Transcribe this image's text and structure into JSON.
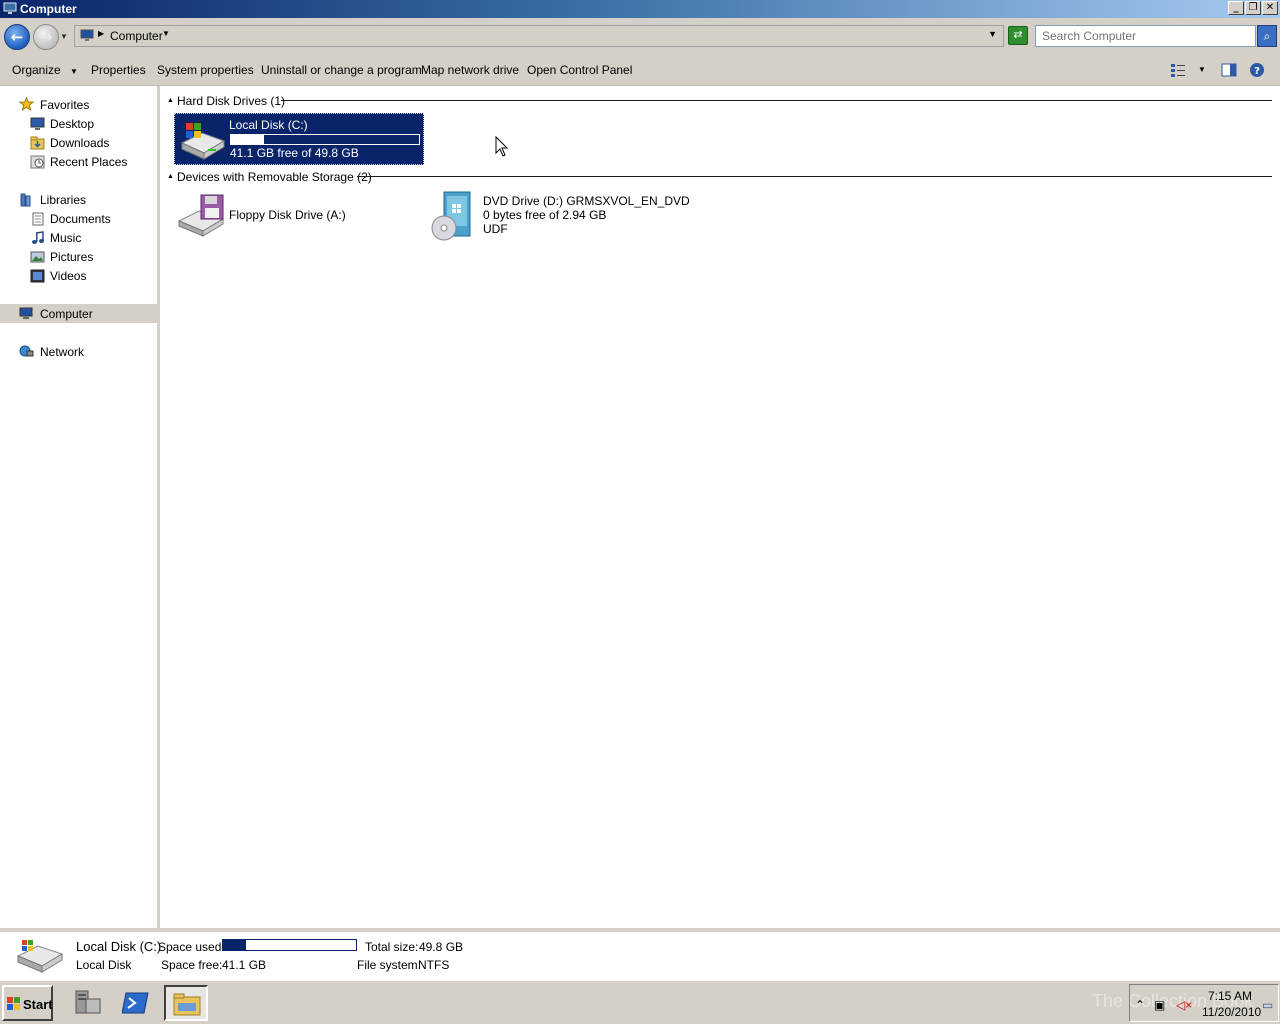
{
  "window": {
    "title": "Computer"
  },
  "address": {
    "crumb": "Computer"
  },
  "search": {
    "placeholder": "Search Computer"
  },
  "toolbar": {
    "organize": "Organize",
    "properties": "Properties",
    "system_properties": "System properties",
    "uninstall": "Uninstall or change a program",
    "map_drive": "Map network drive",
    "control_panel": "Open Control Panel"
  },
  "nav": {
    "favorites": "Favorites",
    "desktop": "Desktop",
    "downloads": "Downloads",
    "recent": "Recent Places",
    "libraries": "Libraries",
    "documents": "Documents",
    "music": "Music",
    "pictures": "Pictures",
    "videos": "Videos",
    "computer": "Computer",
    "network": "Network"
  },
  "groups": {
    "hdd": "Hard Disk Drives (1)",
    "removable": "Devices with Removable Storage (2)"
  },
  "drives": {
    "c": {
      "name": "Local Disk (C:)",
      "free_text": "41.1 GB free of 49.8 GB",
      "used_fraction": 0.175
    },
    "a": {
      "name": "Floppy Disk Drive (A:)"
    },
    "d": {
      "name": "DVD Drive (D:) GRMSXVOL_EN_DVD",
      "free_text": "0 bytes free of 2.94 GB",
      "fs": "UDF"
    }
  },
  "details": {
    "name": "Local Disk (C:)",
    "type": "Local Disk",
    "space_used_label": "Space used:",
    "space_free_label": "Space free:",
    "space_free": "41.1 GB",
    "total_label": "Total size:",
    "total": "49.8 GB",
    "fs_label": "File system:",
    "fs": "NTFS",
    "used_fraction": 0.175
  },
  "taskbar": {
    "start": "Start",
    "time": "7:15 AM",
    "date": "11/20/2010",
    "watermark": "The Collection Book"
  }
}
